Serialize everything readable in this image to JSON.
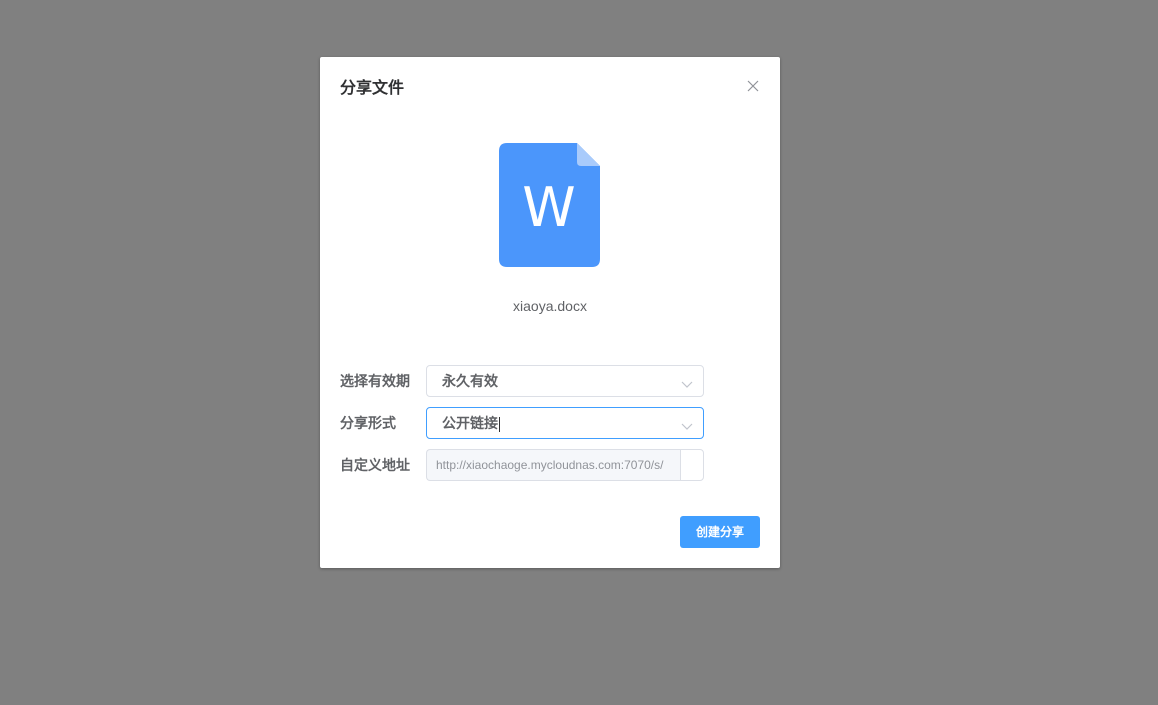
{
  "dialog": {
    "title": "分享文件",
    "close_icon": "close-icon",
    "file": {
      "icon": "word-document-icon",
      "icon_letter": "W",
      "icon_color": "#4b96fb",
      "name": "xiaoya.docx"
    },
    "form": {
      "expiry": {
        "label": "选择有效期",
        "value": "永久有效"
      },
      "share_type": {
        "label": "分享形式",
        "value": "公开链接"
      },
      "custom_address": {
        "label": "自定义地址",
        "prefix": "http://xiaochaoge.mycloudnas.com:7070/s/",
        "value": ""
      }
    },
    "submit_label": "创建分享",
    "accent_color": "#409eff"
  }
}
